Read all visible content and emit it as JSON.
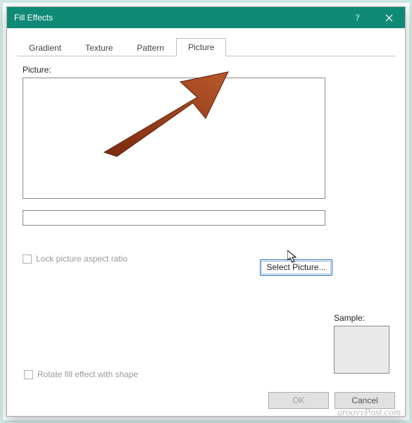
{
  "dialog": {
    "title": "Fill Effects"
  },
  "tabs": {
    "gradient": "Gradient",
    "texture": "Texture",
    "pattern": "Pattern",
    "picture": "Picture"
  },
  "picture_tab": {
    "picture_label": "Picture:",
    "select_button": "Select Picture...",
    "lock_aspect": "Lock picture aspect ratio",
    "sample_label": "Sample:",
    "rotate_label": "Rotate fill effect with shape"
  },
  "footer": {
    "ok": "OK",
    "cancel": "Cancel"
  },
  "watermark": "groovyPost.com"
}
